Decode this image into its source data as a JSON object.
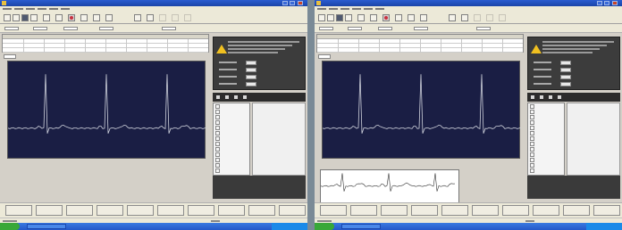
{
  "colors": {
    "trace": "#cfd2dc",
    "plot_bg": "#1a1e44",
    "warning": "#f0c020"
  },
  "icons": [
    "warning-icon",
    "toolbar-icon",
    "start-icon"
  ],
  "panels": [
    {
      "id": "left",
      "has_subplot": false
    },
    {
      "id": "right",
      "has_subplot": true
    }
  ]
}
